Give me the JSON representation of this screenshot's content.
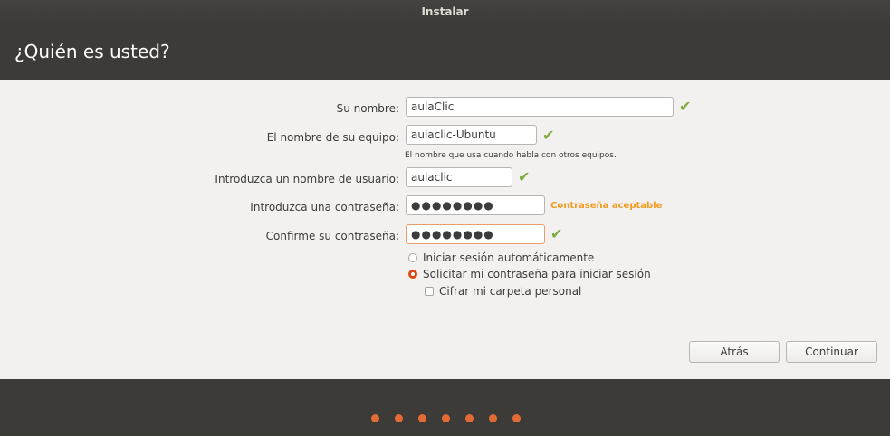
{
  "window": {
    "title": "Instalar"
  },
  "page": {
    "title": "¿Quién es usted?"
  },
  "form": {
    "name_label": "Su nombre:",
    "name_value": "aulaClic",
    "computer_label": "El nombre de su equipo:",
    "computer_value": "aulaclic-Ubuntu",
    "computer_hint": "El nombre que usa cuando habla con otros equipos.",
    "username_label": "Introduzca un nombre de usuario:",
    "username_value": "aulaclic",
    "password_label": "Introduzca una contraseña:",
    "password_value": "●●●●●●●●",
    "password_strength": "Contraseña aceptable",
    "confirm_label": "Confirme su contraseña:",
    "confirm_value": "●●●●●●●●",
    "check_mark": "✔",
    "login_auto": "Iniciar sesión automáticamente",
    "login_password": "Solicitar mi contraseña para iniciar sesión",
    "encrypt_home": "Cifrar mi carpeta personal"
  },
  "buttons": {
    "back": "Atrás",
    "continue": "Continuar"
  },
  "colors": {
    "accent": "#dd4814",
    "ok": "#7cad3c",
    "strength": "#f29a1f"
  }
}
